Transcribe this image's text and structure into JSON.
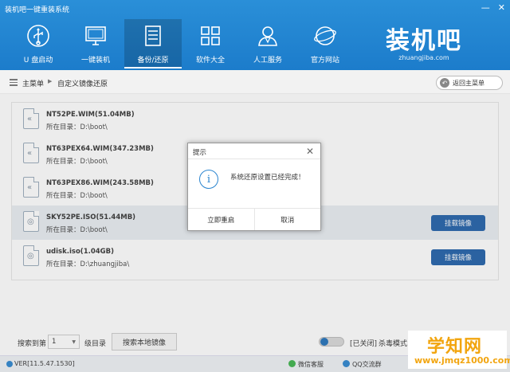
{
  "window": {
    "title": "装机吧一键重装系统",
    "controls": [
      "—",
      "✕"
    ]
  },
  "nav": {
    "items": [
      {
        "label": "U 盘启动",
        "icon": "usb-icon"
      },
      {
        "label": "一键装机",
        "icon": "monitor-icon"
      },
      {
        "label": "备份/还原",
        "icon": "backup-icon",
        "active": true
      },
      {
        "label": "软件大全",
        "icon": "apps-grid-icon"
      },
      {
        "label": "人工服务",
        "icon": "support-person-icon"
      },
      {
        "label": "官方网站",
        "icon": "globe-icon"
      }
    ]
  },
  "brand": {
    "name": "装机吧",
    "url": "zhuangjiba.com"
  },
  "breadcrumb": {
    "root": "主菜单",
    "current": "自定义镜像还原",
    "back_button": "返回主菜单"
  },
  "images": [
    {
      "name": "NT52PE.WIM(51.04MB)",
      "path": "所在目录：D:\\boot\\",
      "icon": "wim-file-icon"
    },
    {
      "name": "NT63PEX64.WIM(347.23MB)",
      "path": "所在目录：D:\\boot\\",
      "icon": "wim-file-icon"
    },
    {
      "name": "NT63PEX86.WIM(243.58MB)",
      "path": "所在目录：D:\\boot\\",
      "icon": "wim-file-icon"
    },
    {
      "name": "SKY52PE.ISO(51.44MB)",
      "path": "所在目录：D:\\boot\\",
      "icon": "iso-file-icon",
      "button": "挂载镜像",
      "selected": true
    },
    {
      "name": "udisk.iso(1.04GB)",
      "path": "所在目录：D:\\zhuangjiba\\",
      "icon": "iso-file-icon",
      "button": "挂载镜像"
    }
  ],
  "dialog": {
    "title": "提示",
    "message": "系统还原设置已经完成！",
    "confirm_button": "立即重启",
    "cancel_button": "取消"
  },
  "bottom": {
    "search_depth_label": "搜索到第",
    "depth_value": "1",
    "depth_unit": "级目录",
    "search_button": "搜索本地镜像",
    "av_status": "[已关闭]",
    "av_mode": "杀毒模式"
  },
  "status": {
    "version": "VER[11.5.47.1530]",
    "wechat": "微信客服",
    "qq": "QQ交流群"
  },
  "watermark": {
    "title": "学知网",
    "url": "www.jmqz1000.com"
  },
  "colors": {
    "header": "#1f83d0",
    "accent": "#1f5fa8",
    "watermark": "#f2a50f"
  }
}
